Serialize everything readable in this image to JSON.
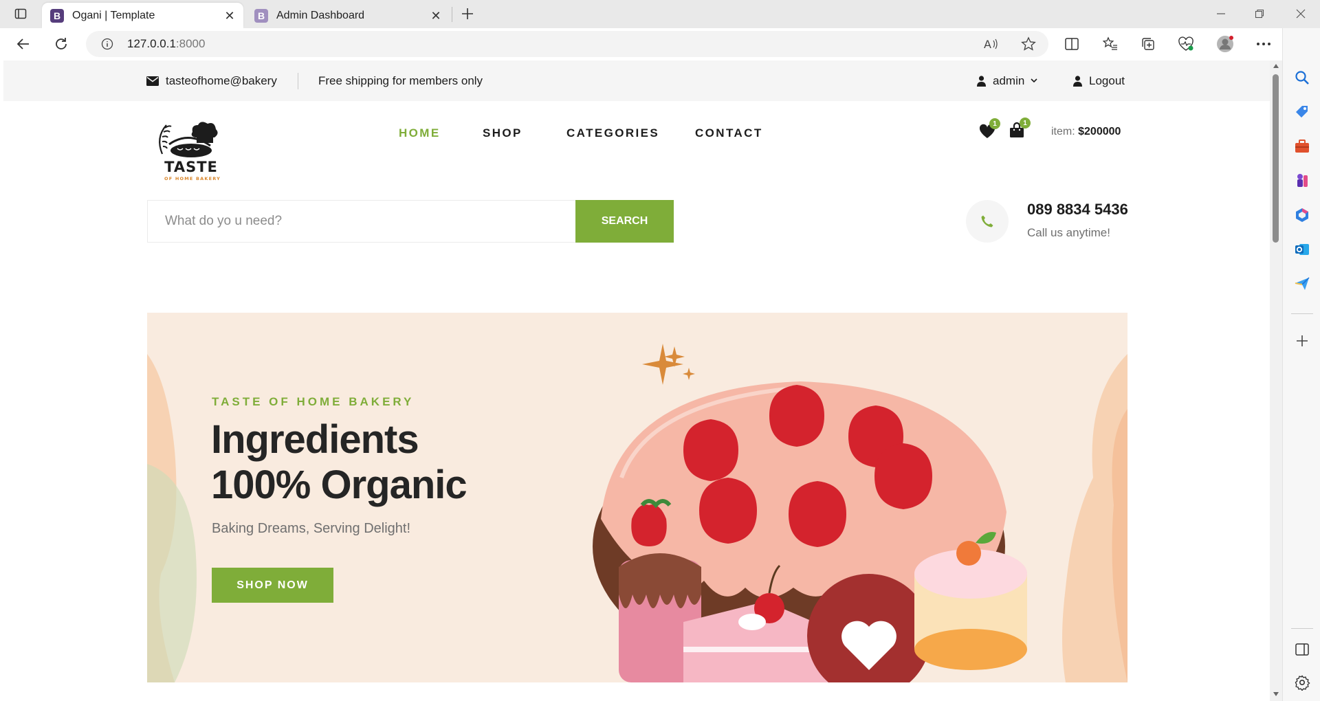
{
  "browser": {
    "tabs": [
      {
        "title": "Ogani | Template",
        "favicon": "B"
      },
      {
        "title": "Admin Dashboard",
        "favicon": "B"
      }
    ],
    "url": {
      "host": "127.0.0.1",
      "port": ":8000"
    }
  },
  "topbar": {
    "email": "tasteofhome@bakery",
    "shipping": "Free shipping for members only",
    "user": "admin",
    "logout": "Logout"
  },
  "logo": {
    "line1": "TASTE",
    "line2": "OF HOME BAKERY"
  },
  "nav": {
    "items": [
      "HOME",
      "SHOP",
      "CATEGORIES",
      "CONTACT"
    ],
    "active": "HOME"
  },
  "cart": {
    "wishlist_count": "1",
    "bag_count": "1",
    "label": "item: ",
    "total": "$200000"
  },
  "search": {
    "placeholder": "What do yo u need?",
    "button": "SEARCH"
  },
  "phone": {
    "number": "089 8834 5436",
    "note": "Call us anytime!"
  },
  "hero": {
    "tag": "TASTE OF HOME BAKERY",
    "title_line1": "Ingredients",
    "title_line2": "100% Organic",
    "subtitle": "Baking Dreams, Serving Delight!",
    "button": "SHOP NOW"
  },
  "colors": {
    "accent": "#7fad39",
    "hero_bg": "#f9ebdf",
    "text_dark": "#1c1c1c"
  }
}
